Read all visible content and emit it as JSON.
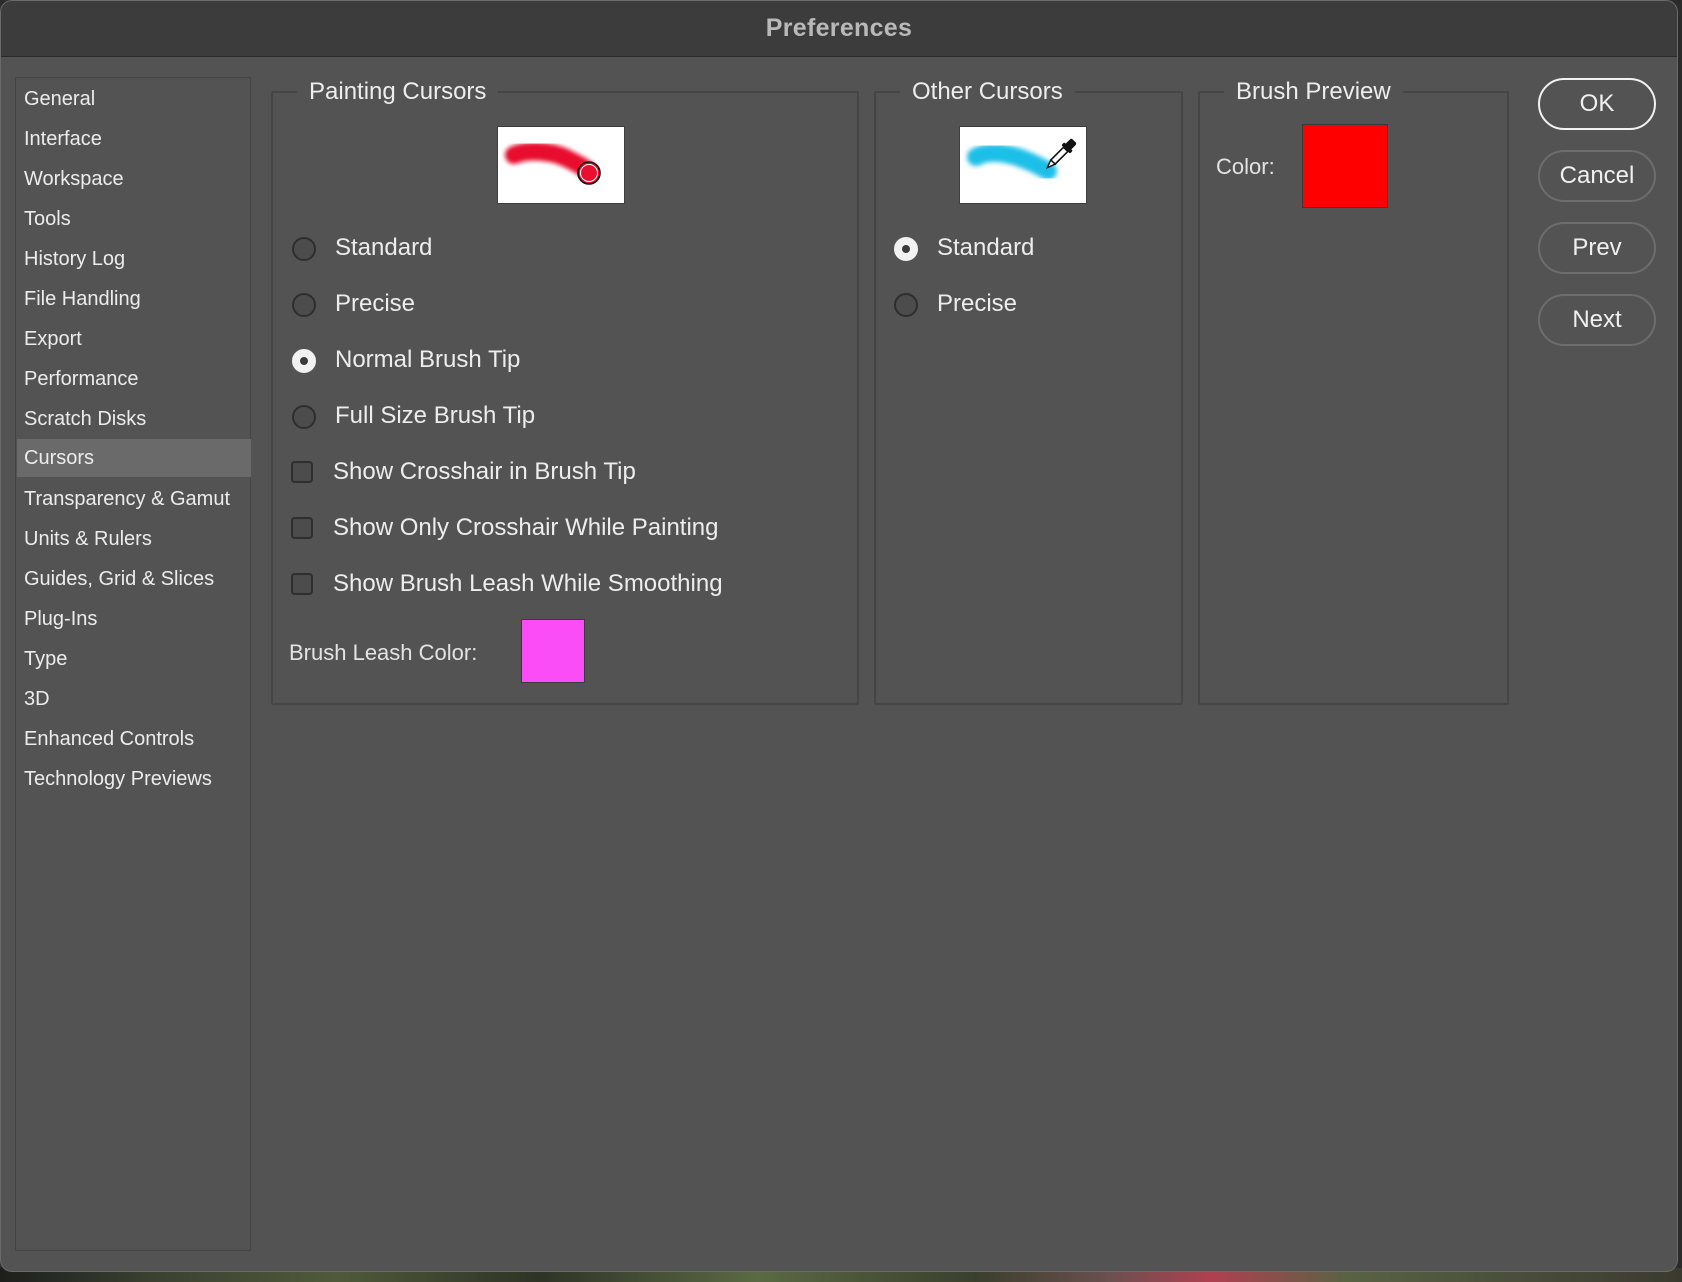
{
  "window": {
    "title": "Preferences"
  },
  "sidebar": {
    "items": [
      {
        "label": "General"
      },
      {
        "label": "Interface"
      },
      {
        "label": "Workspace"
      },
      {
        "label": "Tools"
      },
      {
        "label": "History Log"
      },
      {
        "label": "File Handling"
      },
      {
        "label": "Export"
      },
      {
        "label": "Performance"
      },
      {
        "label": "Scratch Disks"
      },
      {
        "label": "Cursors"
      },
      {
        "label": "Transparency & Gamut"
      },
      {
        "label": "Units & Rulers"
      },
      {
        "label": "Guides, Grid & Slices"
      },
      {
        "label": "Plug-Ins"
      },
      {
        "label": "Type"
      },
      {
        "label": "3D"
      },
      {
        "label": "Enhanced Controls"
      },
      {
        "label": "Technology Previews"
      }
    ],
    "selected": "Cursors"
  },
  "painting_cursors": {
    "title": "Painting Cursors",
    "options": [
      {
        "label": "Standard",
        "selected": false
      },
      {
        "label": "Precise",
        "selected": false
      },
      {
        "label": "Normal Brush Tip",
        "selected": true
      },
      {
        "label": "Full Size Brush Tip",
        "selected": false
      }
    ],
    "checkboxes": [
      {
        "label": "Show Crosshair in Brush Tip",
        "checked": false
      },
      {
        "label": "Show Only Crosshair While Painting",
        "checked": false
      },
      {
        "label": "Show Brush Leash While Smoothing",
        "checked": false
      }
    ],
    "leash_color_label": "Brush Leash Color:",
    "leash_color": "#fa4cf7",
    "preview_stroke_color": "#e8102e"
  },
  "other_cursors": {
    "title": "Other Cursors",
    "options": [
      {
        "label": "Standard",
        "selected": true
      },
      {
        "label": "Precise",
        "selected": false
      }
    ],
    "preview_stroke_color": "#1fbfe8"
  },
  "brush_preview": {
    "title": "Brush Preview",
    "color_label": "Color:",
    "color": "#ff0000"
  },
  "buttons": {
    "ok": "OK",
    "cancel": "Cancel",
    "prev": "Prev",
    "next": "Next"
  }
}
